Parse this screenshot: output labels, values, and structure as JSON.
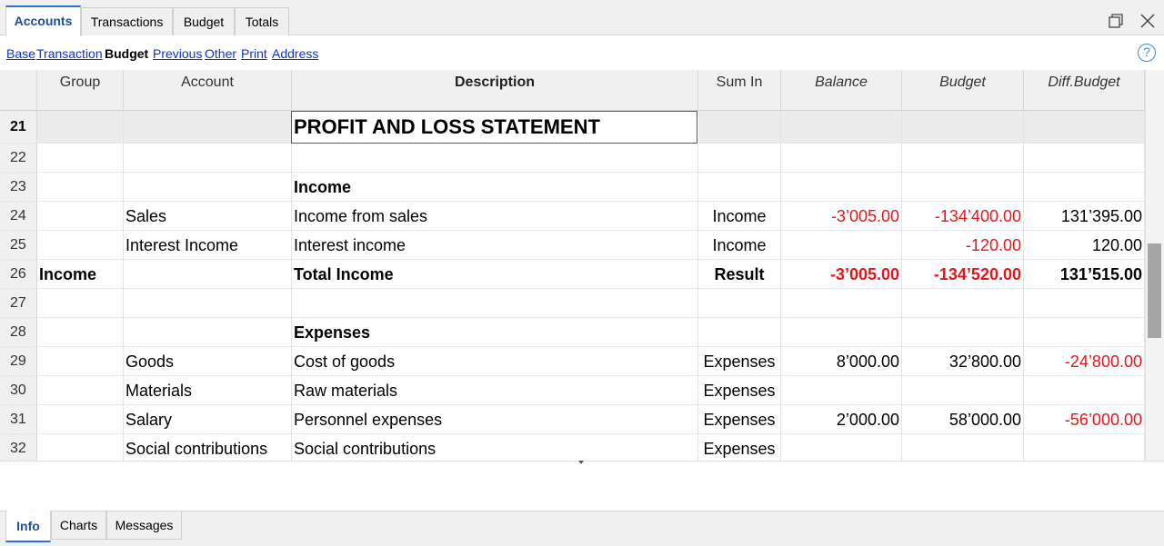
{
  "top_tabs": [
    "Accounts",
    "Transactions",
    "Budget",
    "Totals"
  ],
  "views": [
    "Base",
    "Transaction",
    "Budget",
    "Previous",
    "Other",
    "Print",
    "Address"
  ],
  "help_glyph": "?",
  "columns": {
    "group": "Group",
    "account": "Account",
    "description": "Description",
    "sum_in": "Sum In",
    "balance": "Balance",
    "budget": "Budget",
    "diff_budget": "Diff.Budget"
  },
  "rows": [
    {
      "n": "21",
      "group": "",
      "account": "",
      "description": "PROFIT AND LOSS STATEMENT",
      "sum_in": "",
      "balance": "",
      "budget": "",
      "diff": ""
    },
    {
      "n": "22",
      "group": "",
      "account": "",
      "description": "",
      "sum_in": "",
      "balance": "",
      "budget": "",
      "diff": ""
    },
    {
      "n": "23",
      "group": "",
      "account": "",
      "description": "Income",
      "sum_in": "",
      "balance": "",
      "budget": "",
      "diff": ""
    },
    {
      "n": "24",
      "group": "",
      "account": "Sales",
      "description": "Income from sales",
      "sum_in": "Income",
      "balance": "-3’005.00",
      "budget": "-134’400.00",
      "diff": "131’395.00"
    },
    {
      "n": "25",
      "group": "",
      "account": "Interest Income",
      "description": "Interest income",
      "sum_in": "Income",
      "balance": "",
      "budget": "-120.00",
      "diff": "120.00"
    },
    {
      "n": "26",
      "group": "Income",
      "account": "",
      "description": "Total Income",
      "sum_in": "Result",
      "balance": "-3’005.00",
      "budget": "-134’520.00",
      "diff": "131’515.00"
    },
    {
      "n": "27",
      "group": "",
      "account": "",
      "description": "",
      "sum_in": "",
      "balance": "",
      "budget": "",
      "diff": ""
    },
    {
      "n": "28",
      "group": "",
      "account": "",
      "description": "Expenses",
      "sum_in": "",
      "balance": "",
      "budget": "",
      "diff": ""
    },
    {
      "n": "29",
      "group": "",
      "account": "Goods",
      "description": "Cost of goods",
      "sum_in": "Expenses",
      "balance": "8’000.00",
      "budget": "32’800.00",
      "diff": "-24’800.00"
    },
    {
      "n": "30",
      "group": "",
      "account": "Materials",
      "description": "Raw materials",
      "sum_in": "Expenses",
      "balance": "",
      "budget": "",
      "diff": ""
    },
    {
      "n": "31",
      "group": "",
      "account": "Salary",
      "description": "Personnel expenses",
      "sum_in": "Expenses",
      "balance": "2’000.00",
      "budget": "58’000.00",
      "diff": "-56’000.00"
    },
    {
      "n": "32",
      "group": "",
      "account": "Social contributions",
      "description": "Social contributions",
      "sum_in": "Expenses",
      "balance": "",
      "budget": "",
      "diff": ""
    }
  ],
  "bottom_tabs": [
    "Info",
    "Charts",
    "Messages"
  ],
  "colors": {
    "negative": "#e8141c",
    "link": "#0c35c8",
    "accent": "#2f6dcf"
  },
  "icons": {
    "restore": "restore-window-icon",
    "close": "close-icon",
    "help": "help-icon"
  }
}
